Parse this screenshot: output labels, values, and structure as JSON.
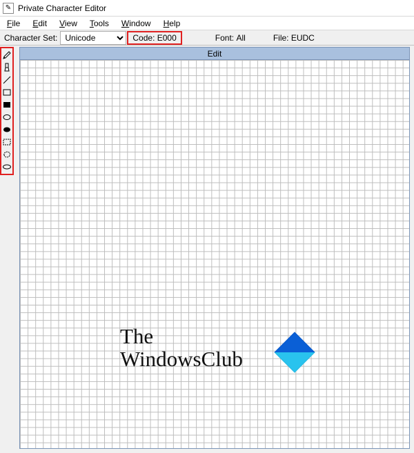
{
  "app": {
    "title": "Private Character Editor",
    "icon_glyph": "✎"
  },
  "menubar": [
    {
      "key": "file",
      "pre": "",
      "u": "F",
      "post": "ile"
    },
    {
      "key": "edit",
      "pre": "",
      "u": "E",
      "post": "dit"
    },
    {
      "key": "view",
      "pre": "",
      "u": "V",
      "post": "iew"
    },
    {
      "key": "tools",
      "pre": "",
      "u": "T",
      "post": "ools"
    },
    {
      "key": "window",
      "pre": "",
      "u": "W",
      "post": "indow"
    },
    {
      "key": "help",
      "pre": "",
      "u": "H",
      "post": "elp"
    }
  ],
  "infobar": {
    "charset_label": "Character Set:",
    "charset_value": "Unicode",
    "code_label": "Code:",
    "code_value": "E000",
    "font_label": "Font:",
    "font_value": "All",
    "file_label": "File:",
    "file_value": "EUDC"
  },
  "canvas": {
    "title": "Edit"
  },
  "tools": [
    {
      "name": "pencil-icon"
    },
    {
      "name": "brush-icon"
    },
    {
      "name": "line-icon"
    },
    {
      "name": "rect-outline-icon"
    },
    {
      "name": "rect-filled-icon"
    },
    {
      "name": "ellipse-outline-icon"
    },
    {
      "name": "ellipse-filled-icon"
    },
    {
      "name": "rect-select-icon"
    },
    {
      "name": "free-select-icon"
    },
    {
      "name": "eraser-icon"
    }
  ],
  "watermark": {
    "line1": "The",
    "line2": "WindowsClub"
  },
  "highlight": {
    "color": "#e02020"
  }
}
